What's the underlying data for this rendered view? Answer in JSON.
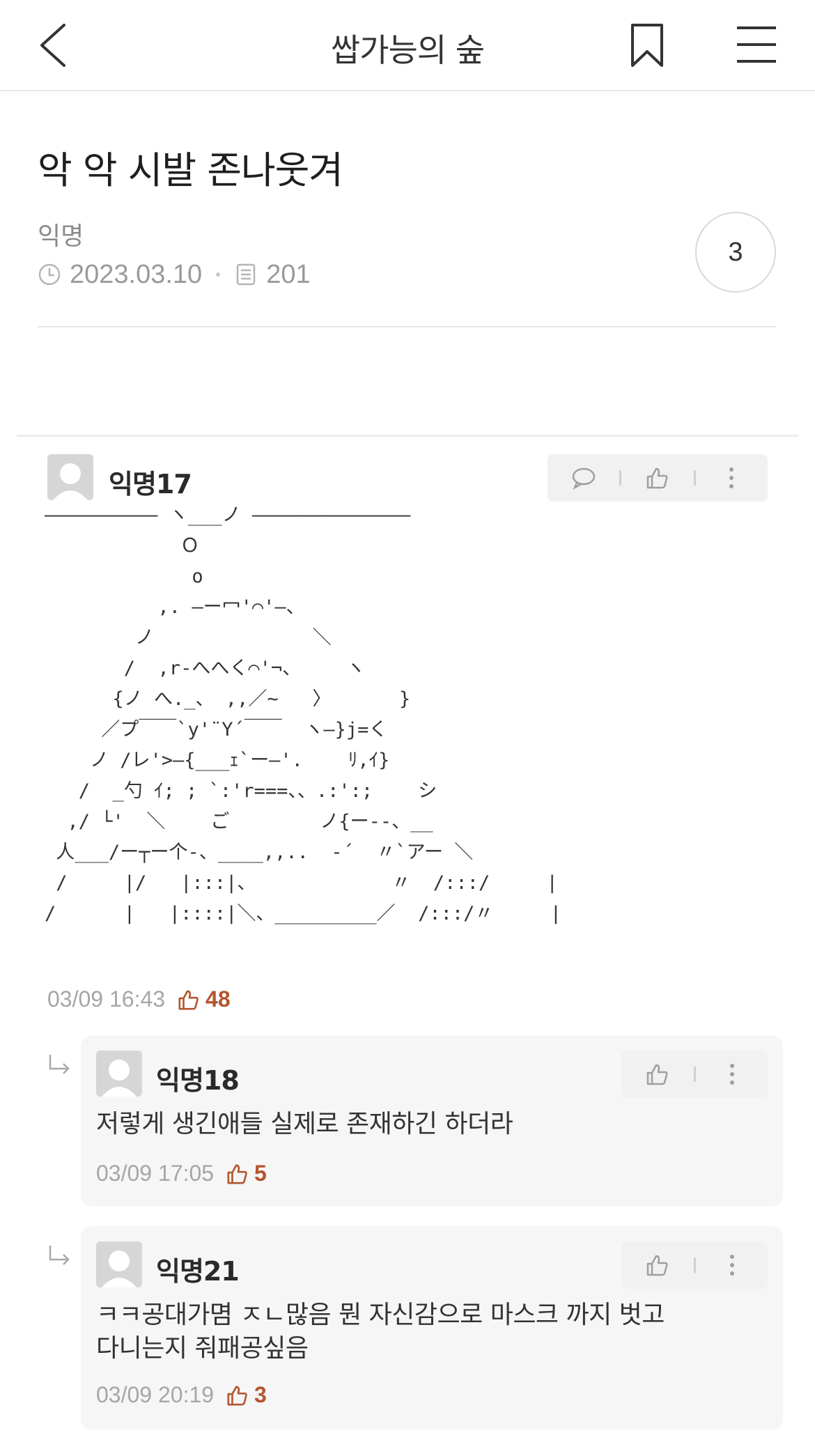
{
  "header": {
    "title": "쌉가능의 숲"
  },
  "post": {
    "title": "악 악 시발 존나웃겨",
    "author": "익명",
    "date": "2023.03.10",
    "views": "201",
    "comment_count": "3"
  },
  "comments": [
    {
      "name": "익명17",
      "ascii_art": "—————————— ヽ___ノ ——————————————\n            Ｏ\n             o\n          ,. ―ー冖'⌒'―、\n        ノ              ＼\n       /  ,r-へへく⌒'¬、    ヽ\n      {ノ へ._、 ,,／~   〉      }\n     ／プ￣￣`y'¨Y´￣￣  ヽ―}j=く\n    ノ /レ'>―{___ｪ`ー―'.    ﾘ,ｲ}\n   /  _勺 ｲ; ; `:'r===、、.:':;    シ\n  ,/ └'  ＼    ご        ノ{ー--、__\n 人___/ー┬ー个-、____,,..  -´  〃`アー ＼\n /     |/   |:::|、            〃  /:::/     |\n/      |   |::::|＼、_________／  /:::/〃     |",
      "time": "03/09 16:43",
      "likes": "48"
    }
  ],
  "replies": [
    {
      "name": "익명18",
      "text": "저렇게 생긴애들 실제로 존재하긴 하더라",
      "time": "03/09 17:05",
      "likes": "5"
    },
    {
      "name": "익명21",
      "text_line1": "ㅋㅋ공대가몀 ㅈㄴ많음 뭔 자신감으로 마스크 까지 벗고",
      "text_line2": "다니는지 줘패공싶음",
      "time": "03/09 20:19",
      "likes": "3"
    }
  ],
  "colors": {
    "like_accent": "#b4552f",
    "meta_gray": "#9a9a9a",
    "reply_bg": "#f6f6f6"
  },
  "icons": [
    "back-icon",
    "bookmark-icon",
    "menu-icon",
    "clock-icon",
    "document-icon",
    "comment-bubble-icon",
    "thumbs-up-icon",
    "more-vertical-icon",
    "reply-arrow-icon",
    "avatar-icon"
  ]
}
